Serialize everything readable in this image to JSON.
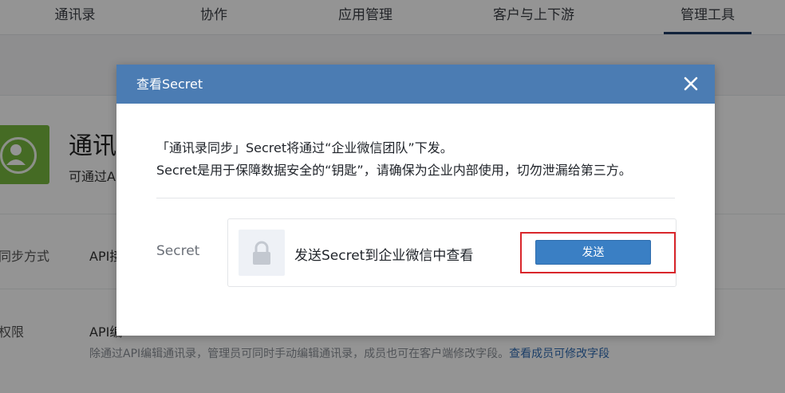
{
  "nav": {
    "tabs": [
      "通讯录",
      "协作",
      "应用管理",
      "客户与上下游",
      "管理工具"
    ],
    "active_index": 4
  },
  "background": {
    "title": "通讯",
    "subtitle": "可通过A",
    "rows": [
      {
        "label": "同步方式",
        "value": "API接"
      },
      {
        "label": "权限",
        "value": "API编"
      }
    ],
    "note": "除通过API编辑通讯录，管理员可同时手动编辑通讯录，成员也可在客户端修改字段。",
    "note_link": "查看成员可修改字段"
  },
  "modal": {
    "title": "查看Secret",
    "close_icon": "close-icon",
    "message_line1": "「通讯录同步」Secret将通过“企业微信团队”下发。",
    "message_line2": "Secret是用于保障数据安全的“钥匙”，请确保为企业内部使用，切勿泄漏给第三方。",
    "secret_label": "Secret",
    "lock_icon": "lock-icon",
    "secret_hint": "发送Secret到企业微信中查看",
    "send_button": "发送"
  },
  "colors": {
    "modal_header": "#4b7cb3",
    "send_button": "#3a7fc4",
    "highlight_border": "#d9262b",
    "app_icon": "#78b83f",
    "active_tab_underline": "#1e3c64"
  }
}
